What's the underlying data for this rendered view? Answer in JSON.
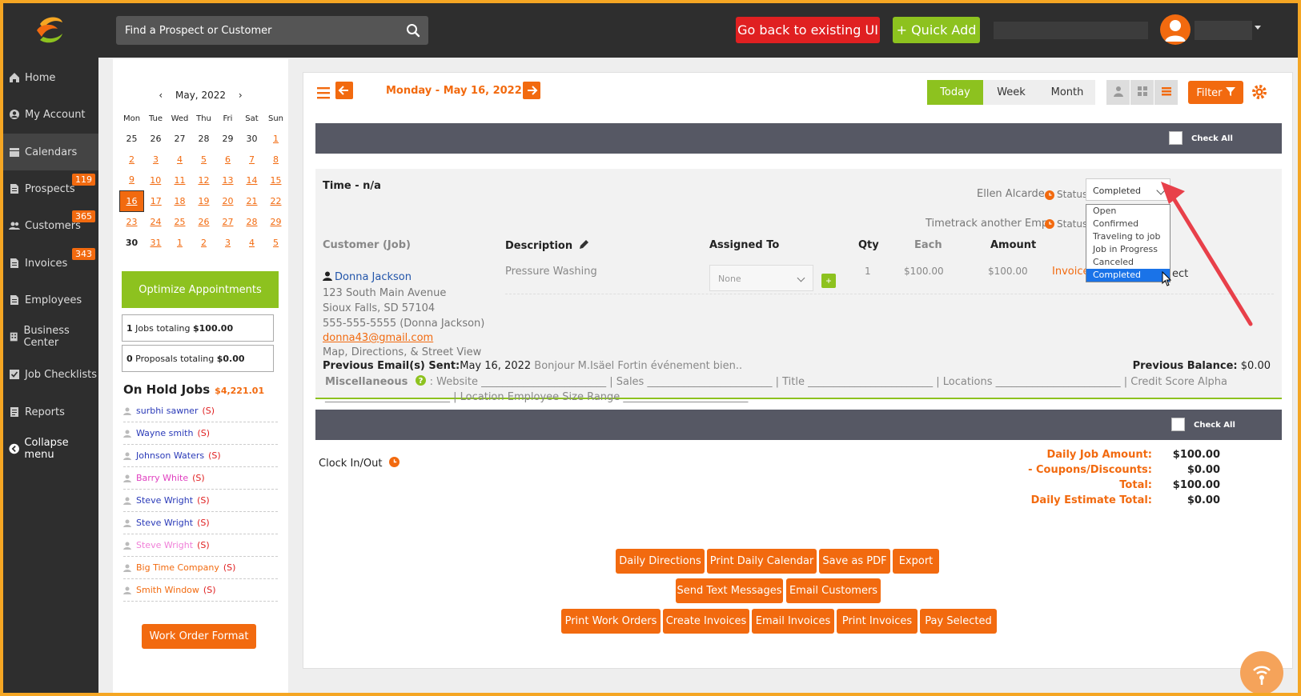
{
  "header": {
    "search_placeholder": "Find a Prospect or Customer",
    "back_button": "Go back to existing UI",
    "quick_add_button": "+ Quick Add"
  },
  "sidebar": {
    "items": [
      {
        "label": "Home",
        "icon": "home-icon"
      },
      {
        "label": "My Account",
        "icon": "user-circle-icon"
      },
      {
        "label": "Calendars",
        "icon": "calendar-icon"
      },
      {
        "label": "Prospects",
        "icon": "document-icon",
        "badge": "119"
      },
      {
        "label": "Customers",
        "icon": "users-icon",
        "badge": "365"
      },
      {
        "label": "Invoices",
        "icon": "document-icon",
        "badge": "343"
      },
      {
        "label": "Employees",
        "icon": "document-icon"
      },
      {
        "label": "Business Center",
        "icon": "building-icon"
      },
      {
        "label": "Job Checklists",
        "icon": "checkbox-icon"
      },
      {
        "label": "Reports",
        "icon": "report-icon"
      },
      {
        "label": "Collapse menu",
        "icon": "collapse-icon"
      }
    ]
  },
  "calendar": {
    "month_label": "May, 2022",
    "weekdays": [
      "Mon",
      "Tue",
      "Wed",
      "Thu",
      "Fri",
      "Sat",
      "Sun"
    ],
    "weeks": [
      [
        "25",
        "26",
        "27",
        "28",
        "29",
        "30",
        "1"
      ],
      [
        "2",
        "3",
        "4",
        "5",
        "6",
        "7",
        "8"
      ],
      [
        "9",
        "10",
        "11",
        "12",
        "13",
        "14",
        "15"
      ],
      [
        "16",
        "17",
        "18",
        "19",
        "20",
        "21",
        "22"
      ],
      [
        "23",
        "24",
        "25",
        "26",
        "27",
        "28",
        "29"
      ],
      [
        "30",
        "31",
        "1",
        "2",
        "3",
        "4",
        "5"
      ]
    ],
    "selected_day": "16"
  },
  "left": {
    "optimize_button": "Optimize Appointments",
    "jobs_count": "1",
    "jobs_text": " Jobs totaling ",
    "jobs_total": "$100.00",
    "proposals_count": "0",
    "proposals_text": " Proposals totaling ",
    "proposals_total": "$0.00",
    "on_hold_title": "On Hold Jobs",
    "on_hold_amount": "$4,221.01",
    "on_hold": [
      {
        "name": "surbhi sawner",
        "tag": "(S)",
        "color": "#2a3ab8"
      },
      {
        "name": "Wayne smith",
        "tag": "(S)",
        "color": "#2a3ab8"
      },
      {
        "name": "Johnson Waters",
        "tag": "(S)",
        "color": "#2a3ab8"
      },
      {
        "name": "Barry White",
        "tag": "(S)",
        "color": "#e040c0"
      },
      {
        "name": "Steve Wright",
        "tag": "(S)",
        "color": "#2a3ab8"
      },
      {
        "name": "Steve Wright",
        "tag": "(S)",
        "color": "#2a3ab8"
      },
      {
        "name": "Steve Wright",
        "tag": "(S)",
        "color": "#f080d8"
      },
      {
        "name": "Big Time Company",
        "tag": "(S)",
        "color": "#f26a0f"
      },
      {
        "name": "Smith Window",
        "tag": "(S)",
        "color": "#f26a0f"
      }
    ],
    "work_order_button": "Work Order Format"
  },
  "toolbar": {
    "date_label": "Monday - May 16, 2022",
    "today": "Today",
    "week": "Week",
    "month": "Month",
    "filter": "Filter"
  },
  "job": {
    "check_all": "Check All",
    "time_label": "Time - n/a",
    "employee": "Ellen Alcarde",
    "timetrack": "Timetrack another Emp.",
    "status_label": "Status:",
    "status_value": "Completed",
    "status_options": [
      "Open",
      "Confirmed",
      "Traveling to job",
      "Job in Progress",
      "Canceled",
      "Completed"
    ],
    "columns": {
      "customer": "Customer (Job)",
      "description": "Description",
      "assigned": "Assigned To",
      "qty": "Qty",
      "each": "Each",
      "amount": "Amount"
    },
    "customer_name": "Donna Jackson",
    "address1": "123 South Main Avenue",
    "address2": "Sioux Falls, SD 57104",
    "phone": "555-555-5555 (Donna Jackson)",
    "email": "donna43@gmail.com",
    "map_link": "Map, Directions, & Street View",
    "description": "Pressure Washing",
    "assigned_value": "None",
    "qty": "1",
    "each": "$100.00",
    "amount": "$100.00",
    "invoice_link": "Invoice",
    "ect_text": "ect",
    "prev_email_label": "Previous Email(s) Sent:",
    "prev_email_date": "May 16, 2022",
    "prev_email_text": " Bonjour M.Isäel Fortin événement bien..",
    "prev_balance_label": "Previous Balance:",
    "prev_balance_value": " $0.00",
    "misc_label": "Miscellaneous",
    "misc_text": " : Website ________________________ | Sales ________________________ | Title ________________________ | Locations ________________________ | Credit Score Alpha ________________________ | Location Employee Size Range ________________________"
  },
  "summary": {
    "clock_in_out": "Clock In/Out",
    "rows": [
      {
        "label": "Daily Job Amount:",
        "value": "$100.00"
      },
      {
        "label": "- Coupons/Discounts:",
        "value": "$0.00"
      },
      {
        "label": "Total:",
        "value": "$100.00"
      },
      {
        "label": "Daily Estimate Total:",
        "value": "$0.00"
      }
    ]
  },
  "actions": {
    "row1": [
      "Daily Directions",
      "Print Daily Calendar",
      "Save as PDF",
      "Export"
    ],
    "row2": [
      "Send Text Messages",
      "Email Customers"
    ],
    "row3": [
      "Print Work Orders",
      "Create Invoices",
      "Email Invoices",
      "Print Invoices",
      "Pay Selected"
    ]
  },
  "colors": {
    "accent": "#f26a0f",
    "green": "#8dc21f",
    "red": "#e02021",
    "dark": "#2e2e2e"
  }
}
